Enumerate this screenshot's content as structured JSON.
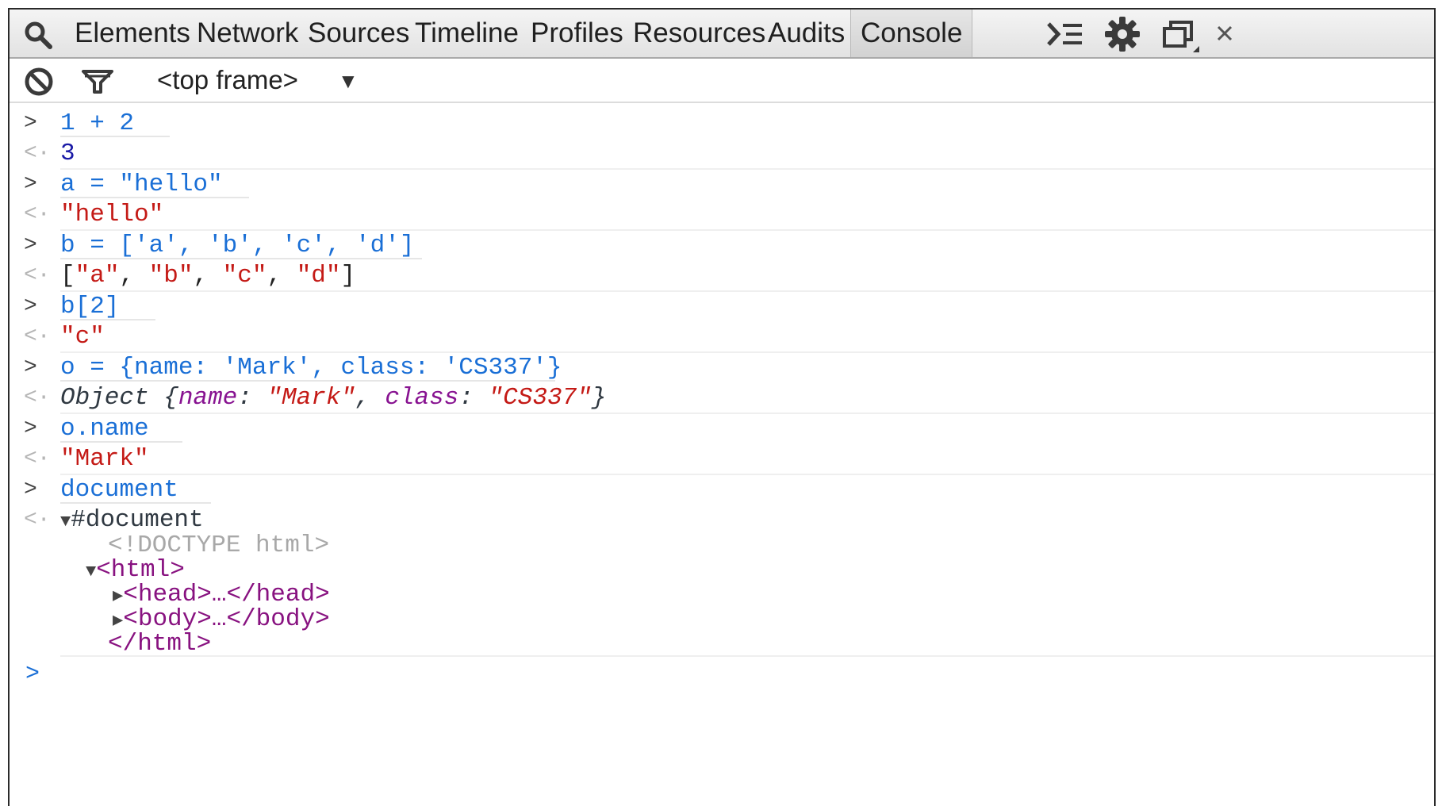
{
  "tabs": [
    "Elements",
    "Network",
    "Sources",
    "Timeline",
    "Profiles",
    "Resources",
    "Audits",
    "Console"
  ],
  "active_tab": "Console",
  "toolbar": {
    "frame_selector": "<top frame>"
  },
  "console": {
    "entries": [
      {
        "input": "1 + 2",
        "output": "3"
      },
      {
        "input": "a = \"hello\"",
        "output": "\"hello\""
      },
      {
        "input": "b = ['a', 'b', 'c', 'd']",
        "output": "[\"a\", \"b\", \"c\", \"d\"]"
      },
      {
        "input": "b[2]",
        "output": "\"c\""
      },
      {
        "input": "o = {name: 'Mark', class: 'CS337'}",
        "output": "Object {name: \"Mark\", class: \"CS337\"}"
      },
      {
        "input": "o.name",
        "output": "\"Mark\""
      },
      {
        "input": "document",
        "output": "#document"
      }
    ],
    "tree": {
      "doctype": "<!DOCTYPE html>",
      "html_open": "<html>",
      "head": "<head>…</head>",
      "body": "<body>…</body>",
      "html_close": "</html>"
    },
    "prompt_symbol": ">"
  },
  "colors": {
    "input_text": "#1a6fd6",
    "string": "#c41a16",
    "number": "#1a1aa6",
    "property": "#881391",
    "tag": "#881280"
  },
  "icons": [
    "search-icon",
    "block-icon",
    "filter-icon",
    "console-drawer-icon",
    "gear-icon",
    "undock-icon",
    "close-icon"
  ]
}
